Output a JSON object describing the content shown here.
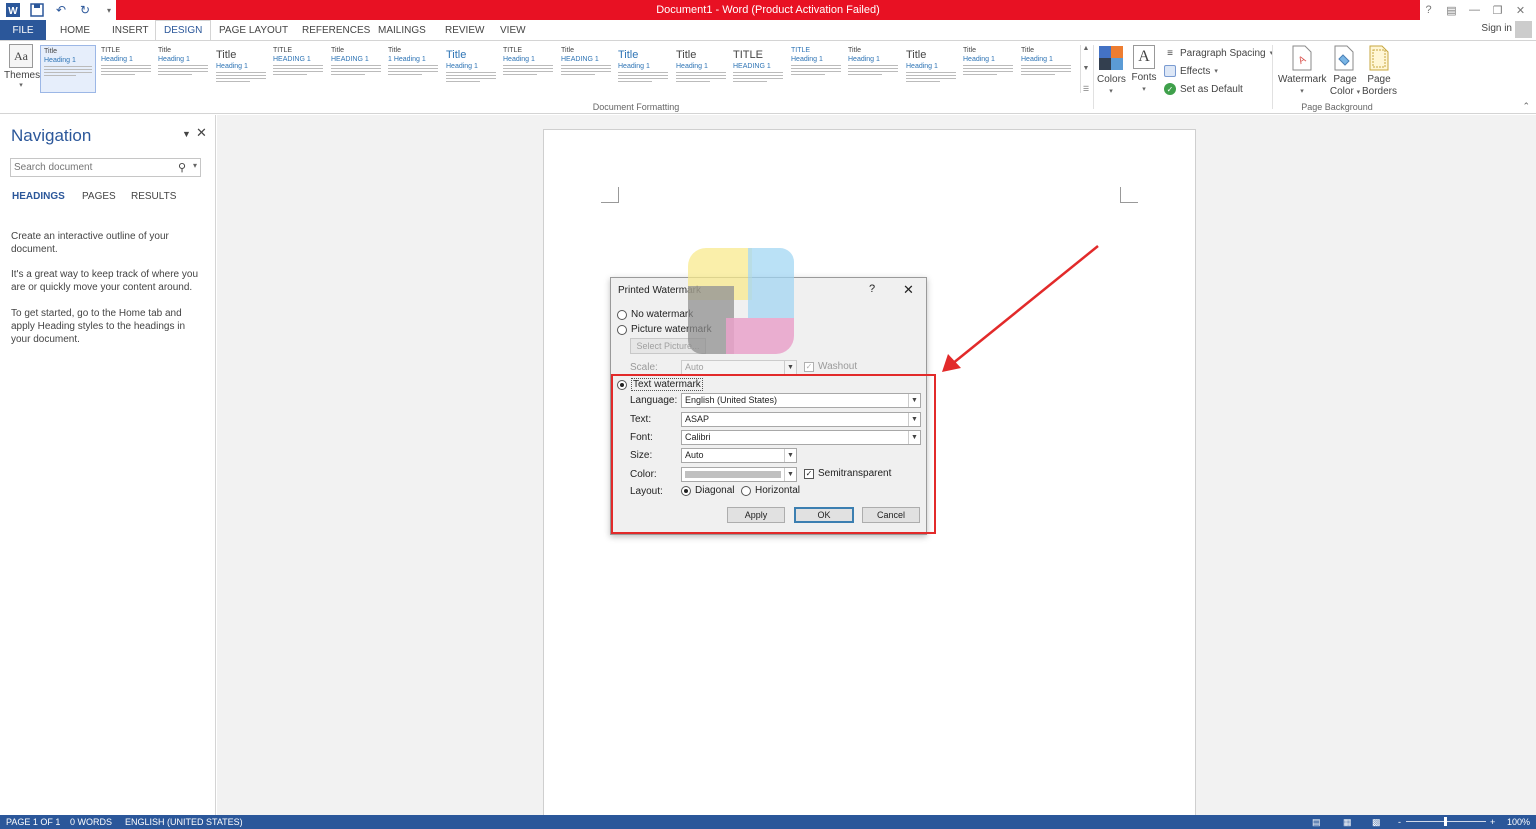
{
  "titlebar": {
    "title": "Document1 - Word (Product Activation Failed)",
    "accent": "#e81123"
  },
  "tabs": {
    "file": "FILE",
    "home": "HOME",
    "insert": "INSERT",
    "design": "DESIGN",
    "page_layout": "PAGE LAYOUT",
    "references": "REFERENCES",
    "mailings": "MAILINGS",
    "review": "REVIEW",
    "view": "VIEW",
    "active": "DESIGN"
  },
  "signin": "Sign in",
  "ribbon": {
    "themes_label": "Themes",
    "themes_icon_text": "Aa",
    "gallery": [
      {
        "title": "Title",
        "heading": "Heading 1"
      },
      {
        "title": "TITLE",
        "heading": "Heading 1"
      },
      {
        "title": "Title",
        "heading": "Heading 1"
      },
      {
        "title": "Title",
        "heading": "Heading 1"
      },
      {
        "title": "TITLE",
        "heading": "HEADING 1"
      },
      {
        "title": "Title",
        "heading": "HEADING 1"
      },
      {
        "title": "Title",
        "heading": "1 Heading 1"
      },
      {
        "title": "Title",
        "heading": "Heading 1"
      },
      {
        "title": "TITLE",
        "heading": "Heading 1"
      },
      {
        "title": "Title",
        "heading": "HEADING 1"
      },
      {
        "title": "Title",
        "heading": "Heading 1"
      },
      {
        "title": "Title",
        "heading": "Heading 1"
      },
      {
        "title": "TITLE",
        "heading": "HEADING 1"
      },
      {
        "title": "TITLE",
        "heading": "Heading 1"
      },
      {
        "title": "Title",
        "heading": "Heading 1"
      },
      {
        "title": "Title",
        "heading": "Heading 1"
      },
      {
        "title": "Title",
        "heading": "Heading 1"
      },
      {
        "title": "Title",
        "heading": "Heading 1"
      }
    ],
    "document_formatting_label": "Document Formatting",
    "colors_label": "Colors",
    "fonts_label": "Fonts",
    "fonts_icon_text": "A",
    "paragraph_spacing_label": "Paragraph Spacing",
    "effects_label": "Effects",
    "set_default_label": "Set as Default",
    "watermark_label": "Watermark",
    "page_color_line1": "Page",
    "page_color_line2": "Color",
    "page_borders_line1": "Page",
    "page_borders_line2": "Borders",
    "page_background_label": "Page Background"
  },
  "navigation": {
    "title": "Navigation",
    "search_placeholder": "Search document",
    "tabs": [
      "HEADINGS",
      "PAGES",
      "RESULTS"
    ],
    "text1": "Create an interactive outline of your document.",
    "text2": "It's a great way to keep track of where you are or quickly move your content around.",
    "text3": "To get started, go to the Home tab and apply Heading styles to the headings in your document."
  },
  "dialog": {
    "title": "Printed Watermark",
    "help": "?",
    "no_watermark": "No watermark",
    "picture_watermark": "Picture watermark",
    "select_picture": "Select Picture...",
    "scale_label": "Scale:",
    "scale_value": "Auto",
    "washout_label": "Washout",
    "text_watermark": "Text watermark",
    "language_label": "Language:",
    "language_value": "English (United States)",
    "text_label": "Text:",
    "text_value": "ASAP",
    "font_label": "Font:",
    "font_value": "Calibri",
    "size_label": "Size:",
    "size_value": "Auto",
    "color_label": "Color:",
    "semitransparent_label": "Semitransparent",
    "layout_label": "Layout:",
    "diagonal_label": "Diagonal",
    "horizontal_label": "Horizontal",
    "apply_label": "Apply",
    "ok_label": "OK",
    "cancel_label": "Cancel",
    "selected_option": "Text watermark",
    "selected_layout": "Diagonal",
    "semitransparent_checked": true,
    "washout_checked": true
  },
  "status": {
    "page": "PAGE 1 OF 1",
    "words": "0 WORDS",
    "language": "ENGLISH (UNITED STATES)",
    "zoom": "100%",
    "zoom_minus": "-",
    "zoom_plus": "+"
  },
  "colors": {
    "brand_blue": "#2b579a",
    "highlight_red": "#e22a2a"
  }
}
